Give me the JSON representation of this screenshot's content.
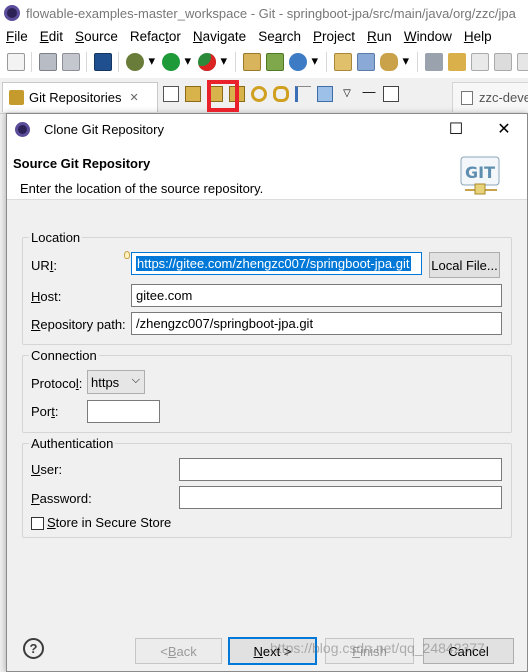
{
  "window": {
    "title": "flowable-examples-master_workspace - Git - springboot-jpa/src/main/java/org/zzc/jpa"
  },
  "menu": [
    {
      "label": "File",
      "mnemonic": "F",
      "rest": "ile"
    },
    {
      "label": "Edit",
      "mnemonic": "E",
      "rest": "dit"
    },
    {
      "label": "Source",
      "mnemonic": "S",
      "rest": "ource"
    },
    {
      "label": "Refactor",
      "mnemonic": "t",
      "pre": "Refac",
      "rest": "or"
    },
    {
      "label": "Navigate",
      "mnemonic": "N",
      "rest": "avigate"
    },
    {
      "label": "Search",
      "mnemonic": "a",
      "pre": "Se",
      "rest": "rch"
    },
    {
      "label": "Project",
      "mnemonic": "P",
      "rest": "roject"
    },
    {
      "label": "Run",
      "mnemonic": "R",
      "rest": "un"
    },
    {
      "label": "Window",
      "mnemonic": "W",
      "rest": "indow"
    },
    {
      "label": "Help",
      "mnemonic": "H",
      "rest": "elp"
    }
  ],
  "view_tab": {
    "label": "Git Repositories",
    "close": "✕"
  },
  "editor_tab": {
    "label": "zzc-deve"
  },
  "dialog": {
    "title": "Clone Git Repository",
    "maximize_symbol": "☐",
    "close_symbol": "✕",
    "header_title": "Source Git Repository",
    "header_message": "Enter the location of the source repository.",
    "logo_text": "GIT",
    "location": {
      "group_label": "Location",
      "uri_label_pre": "UR",
      "uri_label_mnemonic": "I",
      "uri_label_post": ":",
      "uri_value": "https://gitee.com/zhengzc007/springboot-jpa.git",
      "local_file_button": "Local File...",
      "host_label_mnemonic": "H",
      "host_label_rest": "ost:",
      "host_value": "gitee.com",
      "repo_path_label_mnemonic": "R",
      "repo_path_label_rest": "epository path:",
      "repo_path_value": "/zhengzc007/springboot-jpa.git"
    },
    "connection": {
      "group_label": "Connection",
      "protocol_label_pre": "Protoco",
      "protocol_label_mnemonic": "l",
      "protocol_label_post": ":",
      "protocol_value": "https",
      "port_label_pre": "Por",
      "port_label_mnemonic": "t",
      "port_label_post": ":",
      "port_value": ""
    },
    "authentication": {
      "group_label": "Authentication",
      "user_label_mnemonic": "U",
      "user_label_rest": "ser:",
      "user_value": "",
      "password_label_mnemonic": "P",
      "password_label_rest": "assword:",
      "password_value": "",
      "store_label_mnemonic": "S",
      "store_label_rest": "tore in Secure Store",
      "store_checked": false
    },
    "buttons": {
      "help": "?",
      "back_pre": "< ",
      "back_mnemonic": "B",
      "back_rest": "ack",
      "next_mnemonic": "N",
      "next_rest": "ext >",
      "finish_mnemonic": "F",
      "finish_rest": "inish",
      "cancel": "Cancel"
    }
  },
  "watermark": "https://blog.csdn.net/qq_24842377",
  "colors": {
    "selection": "#0078d7",
    "highlight_box": "#e8212b",
    "git_logo": "#5f8fb0"
  }
}
